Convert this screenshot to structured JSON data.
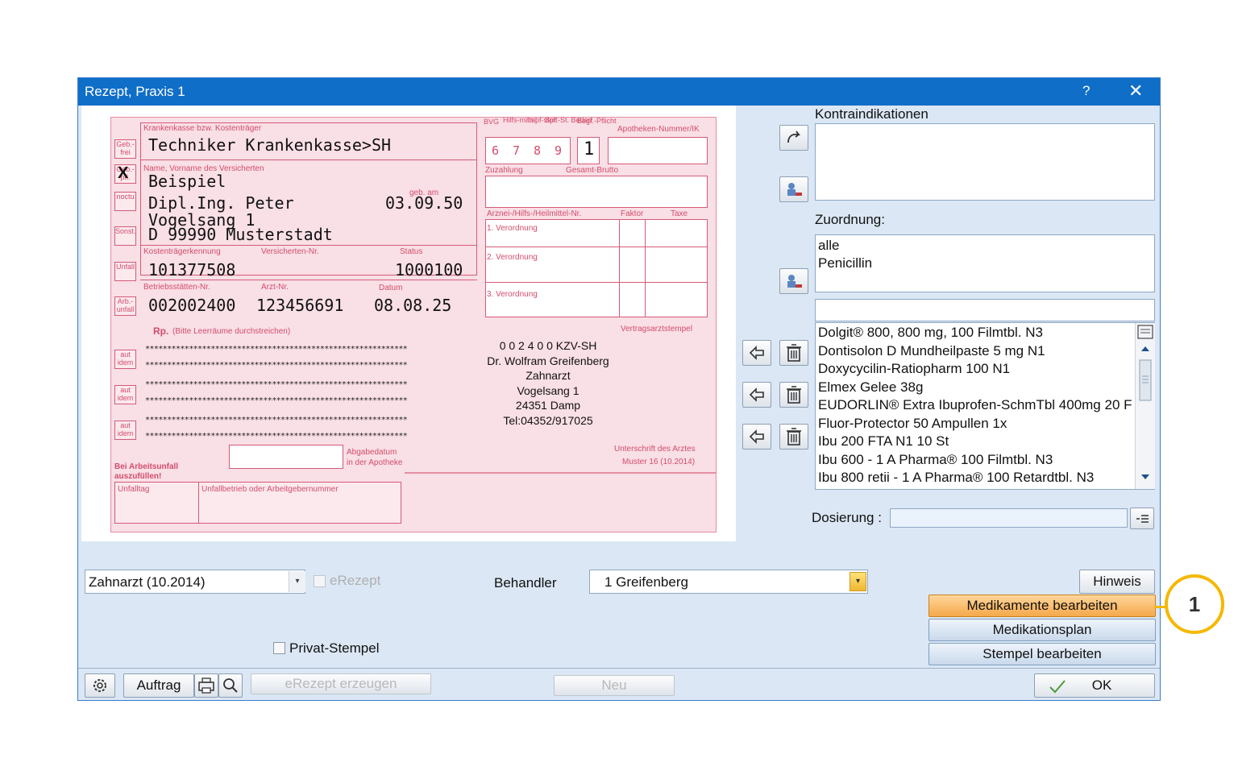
{
  "window": {
    "title": "Rezept, Praxis 1",
    "help": "?",
    "close": "✕"
  },
  "form": {
    "kasse_label": "Krankenkasse bzw. Kostenträger",
    "kasse_value": "Techniker Krankenkasse>SH",
    "name_label": "Name, Vorname des Versicherten",
    "line1": "Beispiel",
    "line2": "Dipl.Ing. Peter",
    "line3": "Vogelsang 1",
    "line4": "D 99990 Musterstadt",
    "geb_label": "geb. am",
    "geb_value": "03.09.50",
    "ktk_label": "Kostenträgerkennung",
    "vnr_label": "Versicherten-Nr.",
    "status_label": "Status",
    "ktk_value": "101377508",
    "status_value": "1000100",
    "bsnr_label": "Betriebsstätten-Nr.",
    "arzt_label": "Arzt-Nr.",
    "datum_label": "Datum",
    "bsnr_value": "002002400",
    "arzt_value": "123456691",
    "datum_value": "08.08.25",
    "side": [
      "Geb.-frei",
      "Geb.-pfl.",
      "noctu",
      "Sonst.",
      "Unfall",
      "Arb.-unfall"
    ],
    "mark": "X",
    "bvg_label": "BVG",
    "hilfs_label": "Hilfs-mittel",
    "impf_label": "Impf-stoff",
    "spr_label": "Spr.-St. Bedarf",
    "begr_label": "Begr.-Pflicht",
    "apo_label": "Apotheken-Nummer/IK",
    "digits": [
      "6",
      "7",
      "8",
      "9"
    ],
    "begr_value": "1",
    "zuzahlung_label": "Zuzahlung",
    "brutto_label": "Gesamt-Brutto",
    "arznei_label": "Arznei-/Hilfs-/Heilmittel-Nr.",
    "faktor_label": "Faktor",
    "taxe_label": "Taxe",
    "v1": "1. Verordnung",
    "v2": "2. Verordnung",
    "v3": "3. Verordnung",
    "rp_label": "Rp.",
    "rp_hint": "(Bitte Leerräume durchstreichen)",
    "stars": "************************************************************",
    "aut_idem": "aut idem",
    "vertrag_label": "Vertragsarztstempel",
    "stamp": [
      "0 0 2 4 0 0 KZV-SH",
      "Dr. Wolfram Greifenberg",
      "Zahnarzt",
      "Vogelsang 1",
      "24351 Damp",
      "Tel:04352/917025"
    ],
    "abgabe_label1": "Abgabedatum",
    "abgabe_label2": "in der Apotheke",
    "unterschrift_label": "Unterschrift des Arztes",
    "muster_label": "Muster 16 (10.2014)",
    "unfall_hint1": "Bei Arbeitsunfall",
    "unfall_hint2": "auszufüllen!",
    "unfalltag_label": "Unfalltag",
    "unfallbetrieb_label": "Unfallbetrieb oder Arbeitgebernummer"
  },
  "right": {
    "kontra_label": "Kontraindikationen",
    "zuordnung_label": "Zuordnung:",
    "zuordnung_items": [
      "alle",
      "Penicillin"
    ],
    "medikamente": [
      "Dolgit® 800, 800 mg, 100 Filmtbl. N3",
      "Dontisolon D Mundheilpaste 5 mg N1",
      "Doxycycilin-Ratiopharm 100 N1",
      "Elmex Gelee 38g",
      "EUDORLIN® Extra Ibuprofen-SchmTbl 400mg 20 F",
      "Fluor-Protector 50 Ampullen 1x",
      "Ibu 200 FTA N1 10 St",
      "Ibu 600 - 1 A Pharma® 100 Filmtbl. N3",
      "Ibu 800 retii - 1 A Pharma® 100 Retardtbl. N3"
    ],
    "dosierung_label": "Dosierung :"
  },
  "bottom": {
    "formular_select": "Zahnarzt (10.2014)",
    "erezept_label": "eRezept",
    "behandler_label": "Behandler",
    "behandler_value": "1 Greifenberg",
    "privat_label": "Privat-Stempel",
    "hinweis": "Hinweis",
    "medikamente_bearbeiten": "Medikamente bearbeiten",
    "medikationsplan": "Medikationsplan",
    "stempel_bearbeiten": "Stempel bearbeiten",
    "auftrag": "Auftrag",
    "erezept_erzeugen": "eRezept erzeugen",
    "neu": "Neu",
    "ok": "OK"
  },
  "callout": {
    "number": "1",
    "color": "#f5b800"
  },
  "colors": {
    "titlebar": "#0f6ec8",
    "form_pink": "#f9dfe6",
    "form_line": "#d45b78",
    "highlight": "#f5a94a"
  }
}
